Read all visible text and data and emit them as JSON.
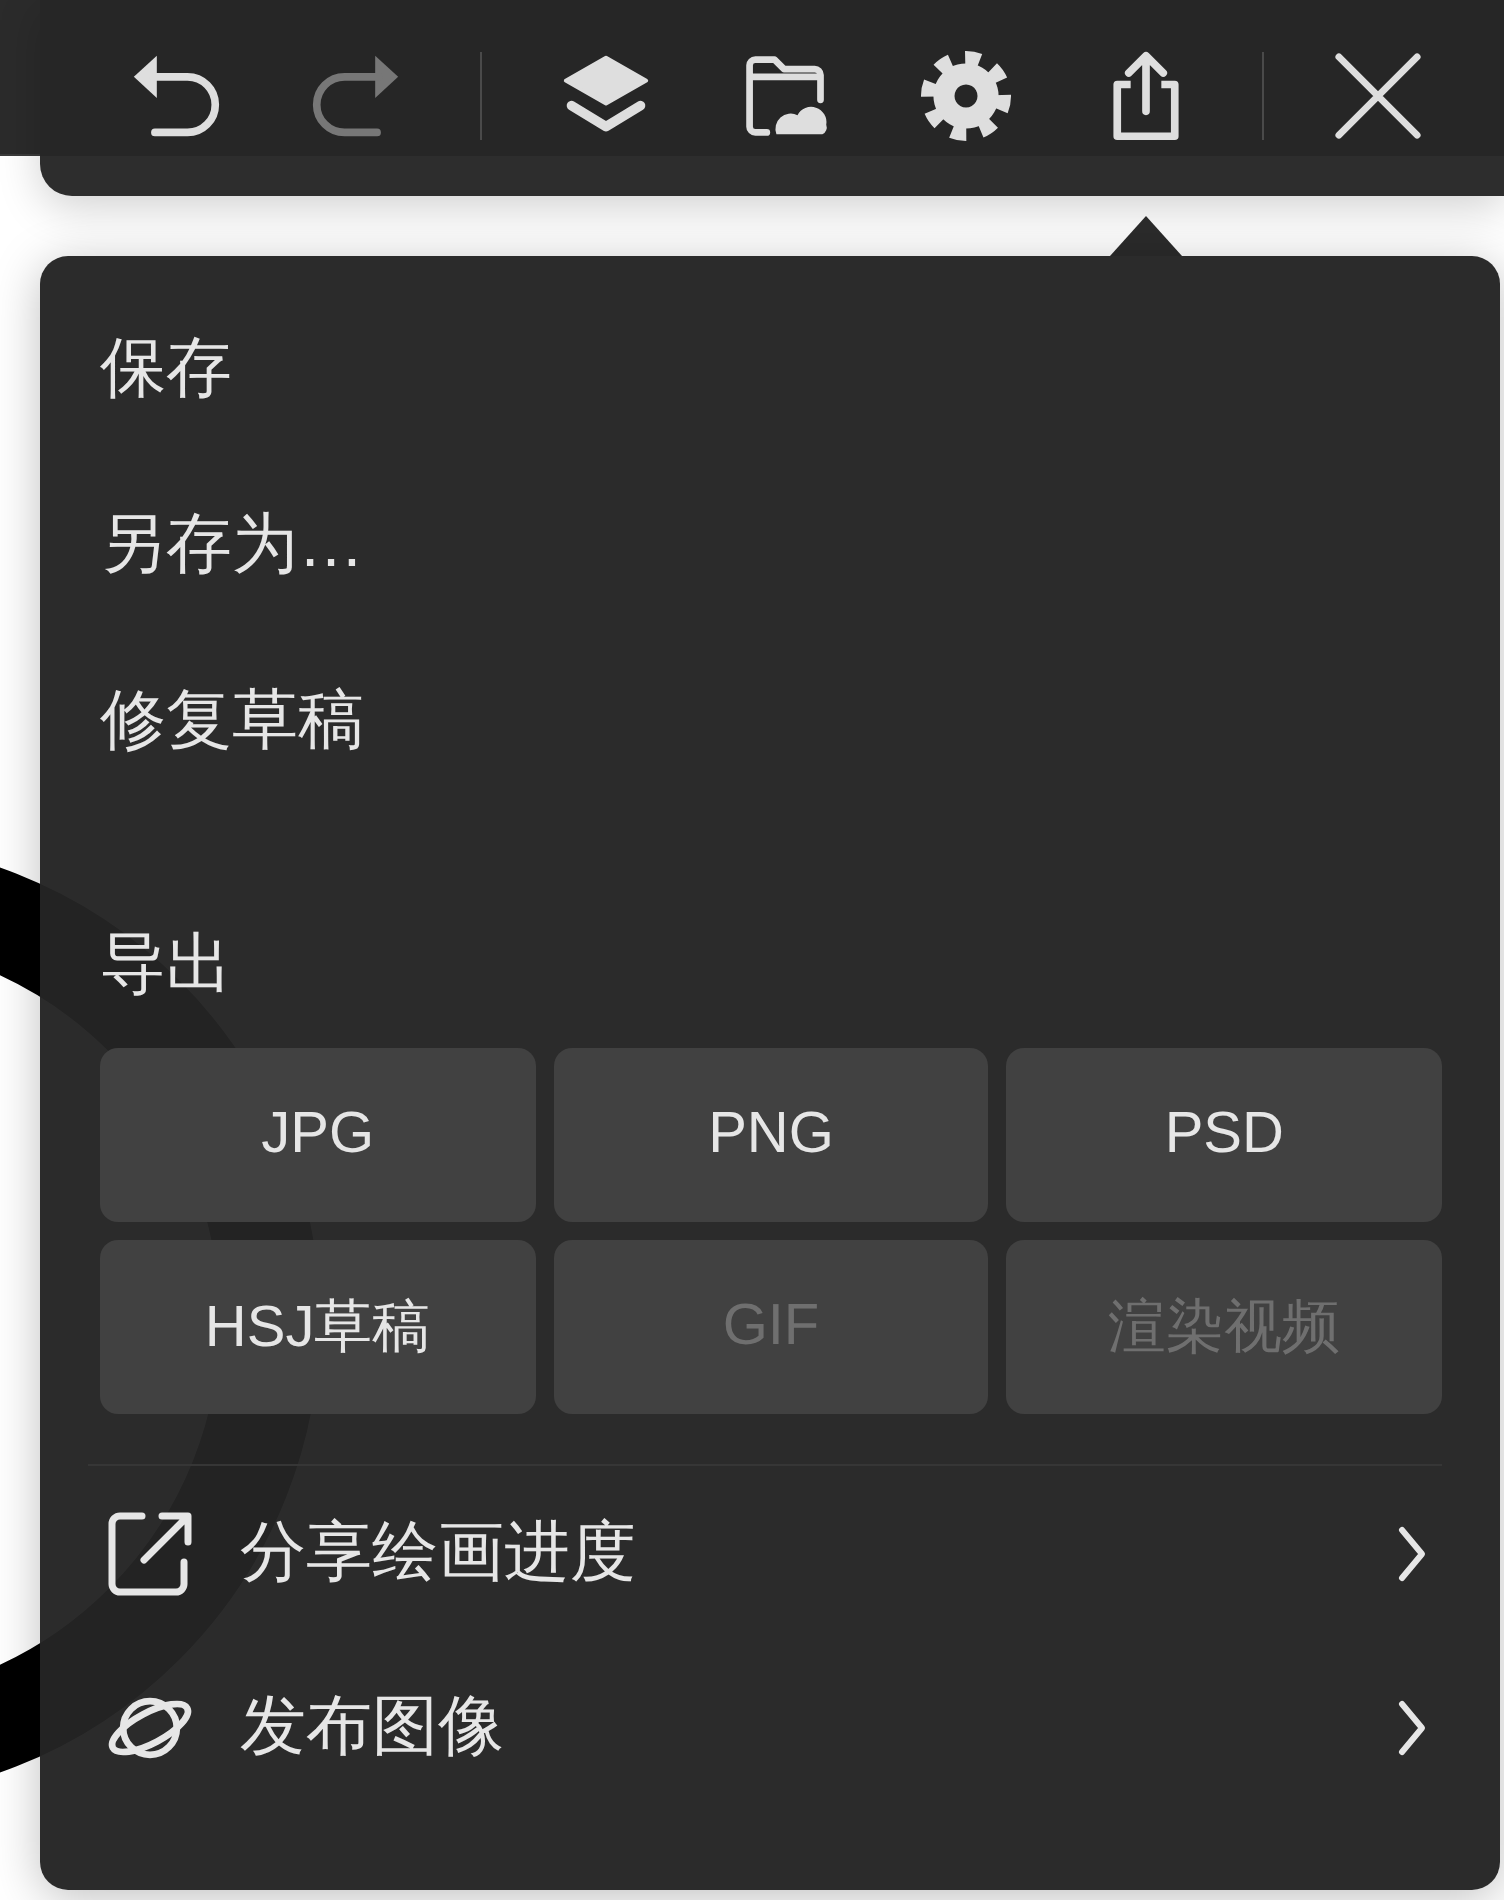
{
  "toolbar": {
    "groups": [
      [
        {
          "kind": "undo",
          "disabled": false
        },
        {
          "kind": "redo",
          "disabled": true
        }
      ],
      [
        {
          "kind": "layers",
          "disabled": false
        },
        {
          "kind": "import",
          "disabled": false
        },
        {
          "kind": "settings",
          "disabled": false
        },
        {
          "kind": "share",
          "disabled": false
        }
      ],
      [
        {
          "kind": "close",
          "disabled": false
        }
      ]
    ]
  },
  "menu": {
    "items": [
      {
        "label": "保存"
      },
      {
        "label": "另存为…"
      },
      {
        "label": "修复草稿"
      }
    ],
    "export": {
      "title": "导出",
      "formats": [
        {
          "label": "JPG",
          "disabled": false
        },
        {
          "label": "PNG",
          "disabled": false
        },
        {
          "label": "PSD",
          "disabled": false
        },
        {
          "label": "HSJ草稿",
          "disabled": false
        },
        {
          "label": "GIF",
          "disabled": true
        },
        {
          "label": "渲染视频",
          "disabled": true
        }
      ]
    },
    "actions": [
      {
        "kind": "share",
        "label": "分享绘画进度"
      },
      {
        "kind": "publish",
        "label": "发布图像"
      }
    ]
  }
}
